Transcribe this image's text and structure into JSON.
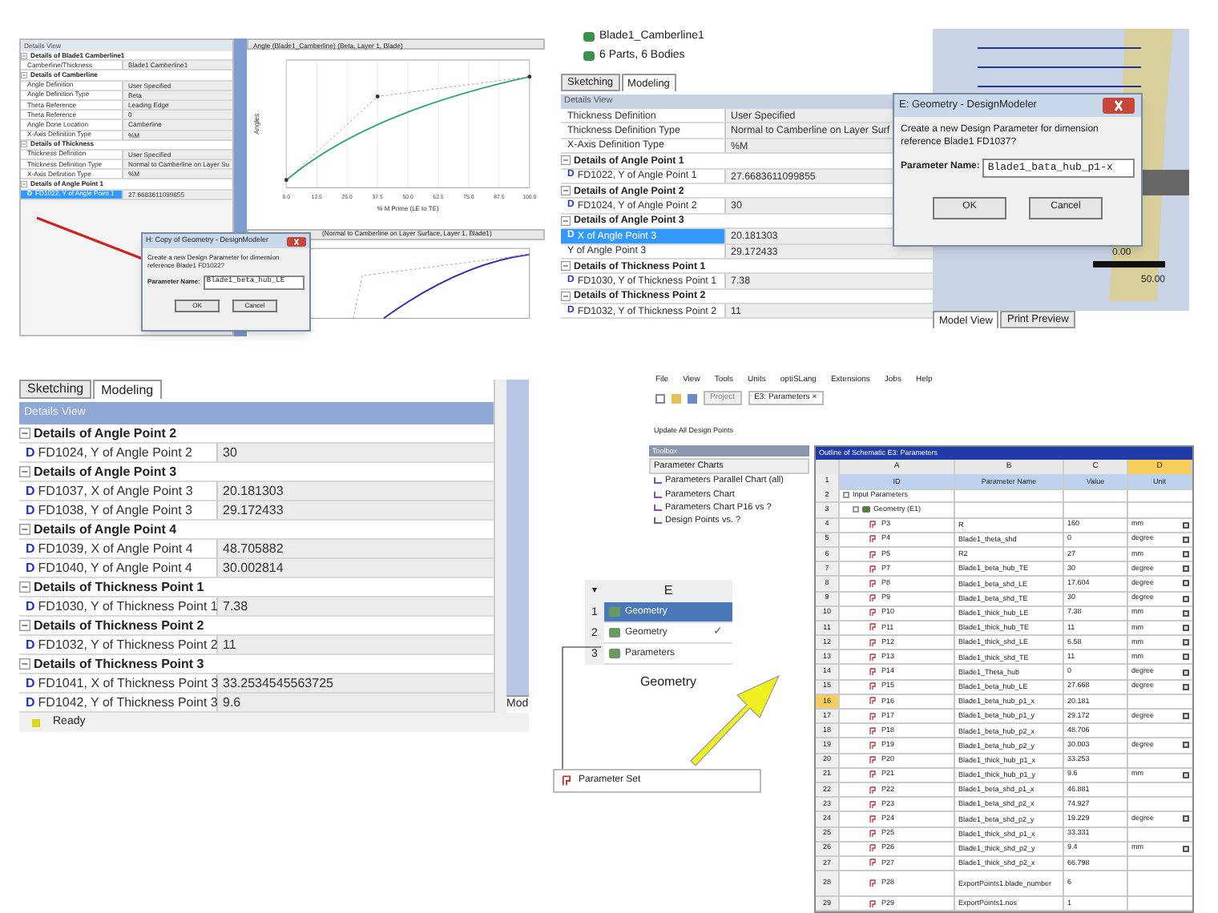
{
  "panel_1": {
    "details_title": "Details View",
    "rows": [
      {
        "kind": "group",
        "label": "Details of Blade1 Camberline1",
        "expanded": true
      },
      {
        "kind": "prop",
        "label": "Camberline/Thickness",
        "value": "Blade1 Camberline1",
        "selected": false
      },
      {
        "kind": "group",
        "label": "Details of Camberline",
        "expanded": true
      },
      {
        "kind": "prop",
        "label": "Angle Definition",
        "value": "User Specified",
        "selected": false
      },
      {
        "kind": "prop",
        "label": "Angle Definition Type",
        "value": "Beta",
        "selected": false
      },
      {
        "kind": "prop",
        "label": "Theta Reference",
        "value": "Leading Edge",
        "selected": false
      },
      {
        "kind": "prop",
        "label": "Theta Reference",
        "value": "0",
        "selected": false
      },
      {
        "kind": "prop",
        "label": "Angle Done Location",
        "value": "Camberline",
        "selected": false
      },
      {
        "kind": "prop",
        "label": "X-Axis Definition Type",
        "value": "%M",
        "selected": false
      },
      {
        "kind": "group",
        "label": "Details of Thickness",
        "expanded": true
      },
      {
        "kind": "prop",
        "label": "Thickness Definition",
        "value": "User Specified",
        "selected": false
      },
      {
        "kind": "prop",
        "label": "Thickness Definition Type",
        "value": "Normal to Camberline on Layer Su",
        "selected": false
      },
      {
        "kind": "prop",
        "label": "X-Axis Definition Type",
        "value": "%M",
        "selected": false
      },
      {
        "kind": "group",
        "label": "Details of Angle Point 1",
        "expanded": true
      },
      {
        "kind": "prop",
        "badge": "D",
        "label": "FD1022, Y of Angle Point 1",
        "value": "27.6683611099855",
        "selected": true
      }
    ],
    "chart_1": {
      "title": "Angle (Blade1_Camberline) (Beta, Layer 1, Blade)",
      "ylabel": "Angles",
      "xlabel": "% M Prime (LE to TE)",
      "xticks": [
        "0.0",
        "12.5",
        "25.0",
        "37.5",
        "50.0",
        "62.5",
        "75.0",
        "87.5",
        "100.0"
      ]
    },
    "chart_2": {
      "title": "(Normal to Camberline on Layer Surface, Layer 1, Blade1)"
    },
    "dialog": {
      "title": "H: Copy of Geometry - DesignModeler",
      "message": "Create a new Design Parameter for dimension reference Blade1 FD1022?",
      "field_label": "Parameter Name:",
      "field_value": "Blade1_beta_hub_LE",
      "buttons": [
        "OK",
        "Cancel"
      ]
    }
  },
  "panel_2": {
    "tree": [
      "Blade1_Camberline1",
      "6 Parts, 6 Bodies"
    ],
    "tabs": [
      {
        "label": "Sketching",
        "selected": false
      },
      {
        "label": "Modeling",
        "selected": true
      }
    ],
    "details_title": "Details View",
    "rows": [
      {
        "kind": "prop",
        "label": "Thickness Definition",
        "value": "User Specified",
        "selected": false
      },
      {
        "kind": "prop",
        "label": "Thickness Definition Type",
        "value": "Normal to Camberline on Layer Surf",
        "selected": false
      },
      {
        "kind": "prop",
        "label": "X-Axis Definition Type",
        "value": "%M",
        "selected": false
      },
      {
        "kind": "group",
        "label": "Details of Angle Point 1",
        "expanded": true
      },
      {
        "kind": "prop",
        "badge": "D",
        "label": "FD1022,  Y of Angle Point 1",
        "value": "27.6683611099855",
        "selected": false
      },
      {
        "kind": "group",
        "label": "Details of Angle Point 2",
        "expanded": true
      },
      {
        "kind": "prop",
        "badge": "D",
        "label": "FD1024,  Y of Angle Point 2",
        "value": "30",
        "selected": false
      },
      {
        "kind": "group",
        "label": "Details of Angle Point 3",
        "expanded": true
      },
      {
        "kind": "prop",
        "badge": "D",
        "label": "X of Angle Point 3",
        "value": "20.181303",
        "selected": true
      },
      {
        "kind": "prop",
        "label": "Y of Angle Point 3",
        "value": "29.172433",
        "selected": false
      },
      {
        "kind": "group",
        "label": "Details of Thickness Point 1",
        "expanded": true
      },
      {
        "kind": "prop",
        "badge": "D",
        "label": "FD1030,  Y of Thickness Point 1",
        "value": "7.38",
        "selected": false
      },
      {
        "kind": "group",
        "label": "Details of Thickness Point 2",
        "expanded": true
      },
      {
        "kind": "prop",
        "badge": "D",
        "label": "FD1032,  Y of Thickness Point 2",
        "value": "11",
        "selected": false
      }
    ],
    "dialog": {
      "title": "E: Geometry - DesignModeler",
      "message": "Create a new Design Parameter for dimension reference Blade1 FD1037?",
      "field_label": "Parameter Name:",
      "field_value": "Blade1_bata_hub_p1-x",
      "buttons": [
        "OK",
        "Cancel"
      ]
    },
    "scale": [
      "0.00",
      "50.00"
    ],
    "view_tabs": [
      {
        "label": "Model View",
        "selected": true
      },
      {
        "label": "Print Preview",
        "selected": false
      }
    ]
  },
  "panel_3": {
    "tabs": [
      {
        "label": "Sketching",
        "selected": false
      },
      {
        "label": "Modeling",
        "selected": true
      }
    ],
    "details_title": "Details View",
    "rows": [
      {
        "kind": "group",
        "label": "Details of Angle Point 2",
        "expanded": true
      },
      {
        "kind": "prop",
        "badge": "D",
        "label": "FD1024,  Y of Angle Point 2",
        "value": "30",
        "selected": false
      },
      {
        "kind": "group",
        "label": "Details of Angle Point 3",
        "expanded": true
      },
      {
        "kind": "prop",
        "badge": "D",
        "label": "FD1037,  X of Angle Point 3",
        "value": "20.181303",
        "selected": false
      },
      {
        "kind": "prop",
        "badge": "D",
        "label": "FD1038,  Y of Angle Point 3",
        "value": "29.172433",
        "selected": false
      },
      {
        "kind": "group",
        "label": "Details of Angle Point 4",
        "expanded": true
      },
      {
        "kind": "prop",
        "badge": "D",
        "label": "FD1039,  X of Angle Point 4",
        "value": "48.705882",
        "selected": false
      },
      {
        "kind": "prop",
        "badge": "D",
        "label": "FD1040,  Y of Angle Point 4",
        "value": "30.002814",
        "selected": false
      },
      {
        "kind": "group",
        "label": "Details of Thickness Point 1",
        "expanded": true
      },
      {
        "kind": "prop",
        "badge": "D",
        "label": "FD1030,  Y of Thickness Point 1",
        "value": "7.38",
        "selected": false
      },
      {
        "kind": "group",
        "label": "Details of Thickness Point 2",
        "expanded": true
      },
      {
        "kind": "prop",
        "badge": "D",
        "label": "FD1032,  Y of Thickness Point 2",
        "value": "11",
        "selected": false
      },
      {
        "kind": "group",
        "label": "Details of Thickness Point 3",
        "expanded": true
      },
      {
        "kind": "prop",
        "badge": "D",
        "label": "FD1041,  X of Thickness Point 3",
        "value": "33.2534545563725",
        "selected": false
      },
      {
        "kind": "prop",
        "badge": "D",
        "label": "FD1042,  Y of Thickness Point 3",
        "value": "9.6",
        "selected": false
      }
    ],
    "status": "Ready",
    "side_tab": "Mod"
  },
  "panel_4": {
    "menu": [
      "File",
      "View",
      "Tools",
      "Units",
      "optiSLang",
      "Extensions",
      "Jobs",
      "Help"
    ],
    "toolbar_tabs": [
      {
        "label": "Project",
        "selected": false
      },
      {
        "label": "E3: Parameters",
        "close": "×",
        "selected": true
      }
    ],
    "update_button": "Update All Design Points",
    "toolbox": {
      "title": "Toolbox",
      "group": "Parameter Charts",
      "items": [
        "Parameters Parallel Chart (all)",
        "Parameters Chart",
        "Parameters Chart P16 vs ?",
        "Design Points vs. ?"
      ]
    },
    "system": {
      "menu": "▾",
      "letter": "E",
      "rows": [
        {
          "num": "1",
          "label": "Geometry",
          "selected": true
        },
        {
          "num": "2",
          "label": "Geometry",
          "status": "✓",
          "selected": false
        },
        {
          "num": "3",
          "label": "Parameters",
          "selected": false
        }
      ],
      "caption": "Geometry"
    },
    "parameter_set": "Parameter Set",
    "table": {
      "title": "Outline of Schematic E3: Parameters",
      "columns": [
        {
          "label": "A",
          "selected": false
        },
        {
          "label": "B",
          "selected": false
        },
        {
          "label": "C",
          "selected": false
        },
        {
          "label": "D",
          "selected": true
        }
      ],
      "rows": [
        {
          "kind": "header",
          "num": "1",
          "cells": [
            "ID",
            "Parameter Name",
            "Value",
            "Unit"
          ]
        },
        {
          "kind": "group",
          "num": "2",
          "label": "Input Parameters"
        },
        {
          "kind": "subgroup",
          "num": "3",
          "label": "Geometry (E1)"
        },
        {
          "kind": "param",
          "num": "4",
          "id": "P3",
          "name": "R",
          "value": "160",
          "unit": "mm",
          "selected": false
        },
        {
          "kind": "param",
          "num": "5",
          "id": "P4",
          "name": "Blade1_theta_shd",
          "value": "0",
          "unit": "degree",
          "selected": false
        },
        {
          "kind": "param",
          "num": "6",
          "id": "P5",
          "name": "R2",
          "value": "27",
          "unit": "mm",
          "selected": false
        },
        {
          "kind": "param",
          "num": "7",
          "id": "P7",
          "name": "Blade1_beta_hub_TE",
          "value": "30",
          "unit": "degree",
          "selected": false
        },
        {
          "kind": "param",
          "num": "8",
          "id": "P8",
          "name": "Blade1_beta_shd_LE",
          "value": "17.604",
          "unit": "degree",
          "selected": false
        },
        {
          "kind": "param",
          "num": "9",
          "id": "P9",
          "name": "Blade1_beta_shd_TE",
          "value": "30",
          "unit": "degree",
          "selected": false
        },
        {
          "kind": "param",
          "num": "10",
          "id": "P10",
          "name": "Blade1_thick_hub_LE",
          "value": "7.38",
          "unit": "mm",
          "selected": false
        },
        {
          "kind": "param",
          "num": "11",
          "id": "P11",
          "name": "Blade1_thick_hub_TE",
          "value": "11",
          "unit": "mm",
          "selected": false
        },
        {
          "kind": "param",
          "num": "12",
          "id": "P12",
          "name": "Blade1_thick_shd_LE",
          "value": "6.58",
          "unit": "mm",
          "selected": false
        },
        {
          "kind": "param",
          "num": "13",
          "id": "P13",
          "name": "Blade1_thick_shd_TE",
          "value": "11",
          "unit": "mm",
          "selected": false
        },
        {
          "kind": "param",
          "num": "14",
          "id": "P14",
          "name": "Blade1_Theta_hub",
          "value": "0",
          "unit": "degree",
          "selected": false
        },
        {
          "kind": "param",
          "num": "15",
          "id": "P15",
          "name": "Blade1_beta_hub_LE",
          "value": "27.668",
          "unit": "degree",
          "selected": false
        },
        {
          "kind": "param",
          "num": "16",
          "id": "P16",
          "name": "Blade1_beta_hub_p1_x",
          "value": "20.181",
          "selected": true
        },
        {
          "kind": "param",
          "num": "17",
          "id": "P17",
          "name": "Blade1_beta_hub_p1_y",
          "value": "29.172",
          "unit": "degree",
          "selected": false
        },
        {
          "kind": "param",
          "num": "18",
          "id": "P18",
          "name": "Blade1_beta_hub_p2_x",
          "value": "48.706",
          "selected": false
        },
        {
          "kind": "param",
          "num": "19",
          "id": "P19",
          "name": "Blade1_beta_hub_p2_y",
          "value": "30.003",
          "unit": "degree",
          "selected": false
        },
        {
          "kind": "param",
          "num": "20",
          "id": "P20",
          "name": "Blade1_thick_hub_p1_x",
          "value": "33.253",
          "selected": false
        },
        {
          "kind": "param",
          "num": "21",
          "id": "P21",
          "name": "Blade1_thick_hub_p1_y",
          "value": "9.6",
          "unit": "mm",
          "selected": false
        },
        {
          "kind": "param",
          "num": "22",
          "id": "P22",
          "name": "Blade1_beta_shd_p1_x",
          "value": "46.881",
          "selected": false
        },
        {
          "kind": "param",
          "num": "23",
          "id": "P23",
          "name": "Blade1_beta_shd_p2_x",
          "value": "74.927",
          "selected": false
        },
        {
          "kind": "param",
          "num": "24",
          "id": "P24",
          "name": "Blade1_beta_shd_p2_y",
          "value": "19.229",
          "unit": "degree",
          "selected": false
        },
        {
          "kind": "param",
          "num": "25",
          "id": "P25",
          "name": "Blade1_thick_shd_p1_x",
          "value": "33.331",
          "selected": false
        },
        {
          "kind": "param",
          "num": "26",
          "id": "P26",
          "name": "Blade1_thick_shd_p2_y",
          "value": "9.4",
          "unit": "mm",
          "selected": false
        },
        {
          "kind": "param",
          "num": "27",
          "id": "P27",
          "name": "Blade1_thick_shd_p2_x",
          "value": "66.798",
          "selected": false
        },
        {
          "kind": "param",
          "num": "28",
          "id": "P28",
          "name": "ExportPoints1.blade_number",
          "value": "6",
          "selected": false
        },
        {
          "kind": "param",
          "num": "29",
          "id": "P29",
          "name": "ExportPoints1.nos",
          "value": "1",
          "selected": false
        }
      ]
    }
  }
}
